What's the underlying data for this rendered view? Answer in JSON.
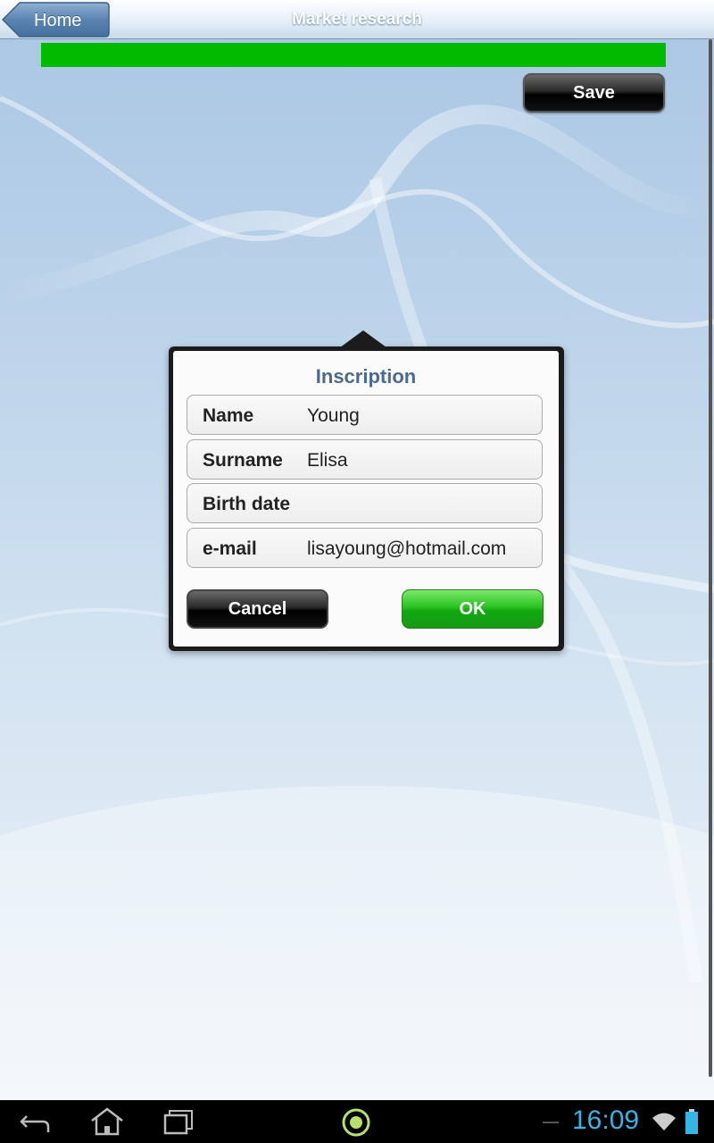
{
  "header": {
    "back_label": "Home",
    "title": "Market research"
  },
  "progress": {
    "fraction": 1.0,
    "color": "#00bb00"
  },
  "toolbar": {
    "save_label": "Save"
  },
  "dialog": {
    "title": "Inscription",
    "fields": [
      {
        "label": "Name",
        "value": "Young"
      },
      {
        "label": "Surname",
        "value": "Elisa"
      },
      {
        "label": "Birth date",
        "value": ""
      },
      {
        "label": "e-mail",
        "value": "lisayoung@hotmail.com"
      }
    ],
    "cancel_label": "Cancel",
    "ok_label": "OK"
  },
  "status_bar": {
    "time": "16:09",
    "icons": [
      "back-icon",
      "home-icon",
      "recent-apps-icon",
      "app-indicator-icon",
      "wifi-icon",
      "battery-icon"
    ]
  },
  "colors": {
    "accent": "#4a6a8e",
    "ok_green": "#29c220",
    "clock": "#33b5e5"
  }
}
